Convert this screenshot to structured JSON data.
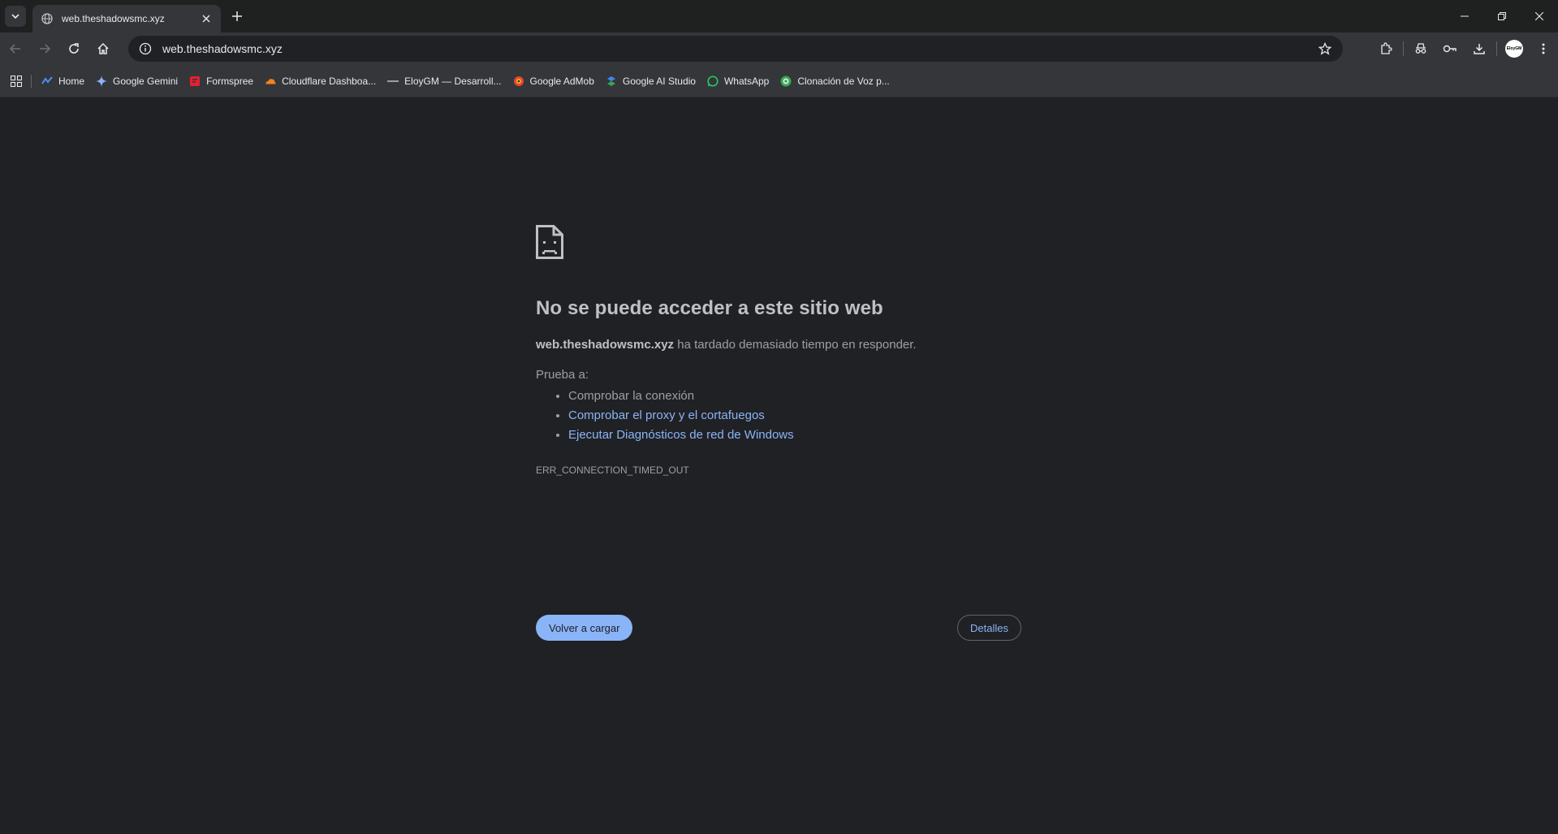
{
  "tab": {
    "title": "web.theshadowsmc.xyz"
  },
  "omnibox": {
    "url": "web.theshadowsmc.xyz"
  },
  "avatar": {
    "text": "EloyGM"
  },
  "bookmarks": [
    {
      "label": "Home",
      "icon": "home-favicon",
      "color": "#4f8ef7"
    },
    {
      "label": "Google Gemini",
      "icon": "gemini-favicon",
      "color": "#8ab4f8"
    },
    {
      "label": "Formspree",
      "icon": "formspree-favicon",
      "color": "#e5202e"
    },
    {
      "label": "Cloudflare Dashboa...",
      "icon": "cloudflare-favicon",
      "color": "#f38020"
    },
    {
      "label": "EloyGM — Desarroll...",
      "icon": "eloygm-favicon",
      "color": "#9aa0a6"
    },
    {
      "label": "Google AdMob",
      "icon": "admob-favicon",
      "color": "#ea4335"
    },
    {
      "label": "Google AI Studio",
      "icon": "aistudio-favicon",
      "color": "#4285f4"
    },
    {
      "label": "WhatsApp",
      "icon": "whatsapp-favicon",
      "color": "#25d366"
    },
    {
      "label": "Clonación de Voz p...",
      "icon": "voice-favicon",
      "color": "#34a853"
    }
  ],
  "error": {
    "title": "No se puede acceder a este sitio web",
    "host": "web.theshadowsmc.xyz",
    "desc_rest": " ha tardado demasiado tiempo en responder.",
    "try_label": "Prueba a:",
    "suggestions": [
      {
        "text": "Comprobar la conexión",
        "link": false
      },
      {
        "text": "Comprobar el proxy y el cortafuegos",
        "link": true
      },
      {
        "text": "Ejecutar Diagnósticos de red de Windows",
        "link": true
      }
    ],
    "code": "ERR_CONNECTION_TIMED_OUT",
    "reload_label": "Volver a cargar",
    "details_label": "Detalles"
  }
}
